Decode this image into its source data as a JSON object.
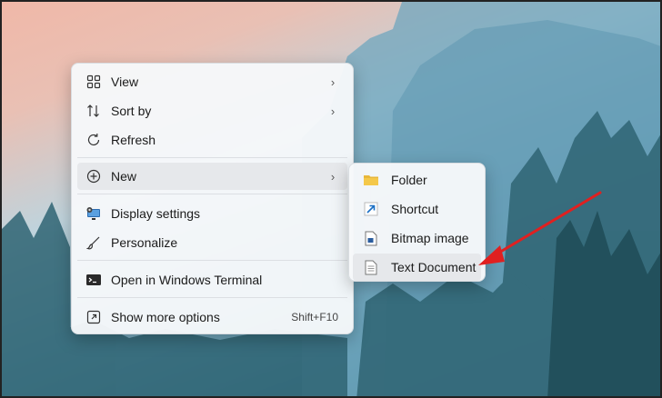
{
  "context_menu": {
    "items": [
      {
        "label": "View",
        "icon": "grid-view-icon"
      },
      {
        "label": "Sort by",
        "icon": "sort-icon"
      },
      {
        "label": "Refresh",
        "icon": "refresh-icon"
      },
      {
        "label": "New",
        "icon": "new-plus-icon"
      },
      {
        "label": "Display settings",
        "icon": "display-icon"
      },
      {
        "label": "Personalize",
        "icon": "brush-icon"
      },
      {
        "label": "Open in Windows Terminal",
        "icon": "terminal-icon"
      },
      {
        "label": "Show more options",
        "icon": "expand-icon",
        "shortcut": "Shift+F10"
      }
    ]
  },
  "new_submenu": {
    "items": [
      {
        "label": "Folder",
        "icon": "folder-icon"
      },
      {
        "label": "Shortcut",
        "icon": "shortcut-icon"
      },
      {
        "label": "Bitmap image",
        "icon": "bitmap-icon"
      },
      {
        "label": "Text Document",
        "icon": "text-document-icon"
      }
    ]
  },
  "colors": {
    "accent_arrow": "#e02020",
    "folder": "#f4c84a",
    "shortcut": "#1a6fc4"
  }
}
